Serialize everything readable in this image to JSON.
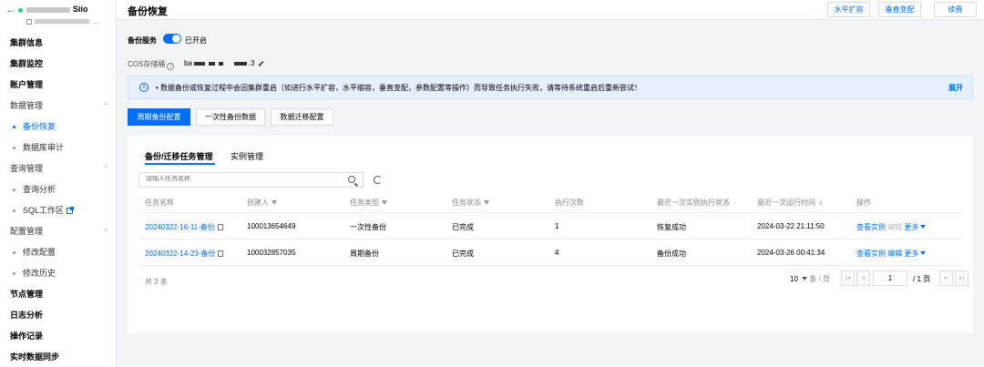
{
  "sidebar": {
    "back": "←",
    "cluster_name": "Siio",
    "cluster_sub": "...",
    "items": [
      {
        "label": "集群信息"
      },
      {
        "label": "集群监控"
      },
      {
        "label": "账户管理"
      },
      {
        "label": "数据管理"
      },
      {
        "label": "备份恢复"
      },
      {
        "label": "数据库审计"
      },
      {
        "label": "查询管理"
      },
      {
        "label": "查询分析"
      },
      {
        "label": "SQL工作区"
      },
      {
        "label": "配置管理"
      },
      {
        "label": "修改配置"
      },
      {
        "label": "修改历史"
      },
      {
        "label": "节点管理"
      },
      {
        "label": "日志分析"
      },
      {
        "label": "操作记录"
      },
      {
        "label": "实时数据同步"
      }
    ]
  },
  "header": {
    "title": "备份恢复",
    "buttons": [
      "水平扩容",
      "垂直变配",
      "续费"
    ]
  },
  "backup_service": {
    "label": "备份服务",
    "status": "已开启"
  },
  "cos": {
    "label": "COS存储桶",
    "value_prefix": "ba",
    "value_suffix": ".3"
  },
  "notice": {
    "text": "• 数据备份或恢复过程中会因集群重启（如进行水平扩容，水平缩容，垂直变配，参数配置等操作）而导致任务执行失败，请等待系统重启后重新尝试！",
    "expand": "展开"
  },
  "actions": [
    "周期备份配置",
    "一次性备份数据",
    "数据迁移配置"
  ],
  "tabs": [
    "备份/迁移任务管理",
    "实例管理"
  ],
  "search": {
    "placeholder": "请输入任务名称"
  },
  "table": {
    "columns": [
      "任务名称",
      "创建人",
      "任务类型",
      "任务状态",
      "执行次数",
      "最近一次实例执行状态",
      "最近一次运行时间",
      "操作"
    ],
    "rows": [
      {
        "name": "20240322-16-11-备份",
        "creator": "100013654649",
        "type": "一次性备份",
        "status": "已完成",
        "count": "1",
        "last_status": "恢复成功",
        "last_time": "2024-03-22 21:11:50",
        "op_view": "查看实例",
        "op_edit": "编辑",
        "op_more": "更多"
      },
      {
        "name": "20240322-14-23-备份",
        "creator": "100032857035",
        "type": "周期备份",
        "status": "已完成",
        "count": "4",
        "last_status": "备份成功",
        "last_time": "2024-03-26 00:41:34",
        "op_view": "查看实例",
        "op_edit": "编辑",
        "op_more": "更多"
      }
    ]
  },
  "pagination": {
    "total": "共 2 条",
    "page_size": "10",
    "page_size_unit": "条 / 页",
    "current": "1",
    "total_pages": "/ 1 页"
  }
}
